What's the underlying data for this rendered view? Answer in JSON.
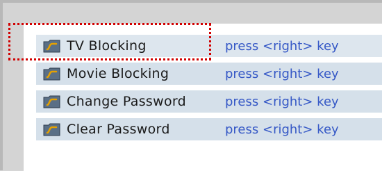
{
  "menu": {
    "items": [
      {
        "label": "TV Blocking",
        "hint": "press <right> key",
        "icon": "folder-icon",
        "selected": true
      },
      {
        "label": "Movie Blocking",
        "hint": "press <right> key",
        "icon": "folder-icon",
        "selected": false
      },
      {
        "label": "Change Password",
        "hint": "press <right> key",
        "icon": "folder-icon",
        "selected": false
      },
      {
        "label": "Clear Password",
        "hint": "press <right> key",
        "icon": "folder-icon",
        "selected": false
      }
    ]
  },
  "colors": {
    "row_background": "#d5e0ea",
    "hint_text": "#3558c6",
    "focus_outline": "#d10000",
    "icon_fill": "#5a6f86",
    "icon_accent": "#e6a100"
  }
}
